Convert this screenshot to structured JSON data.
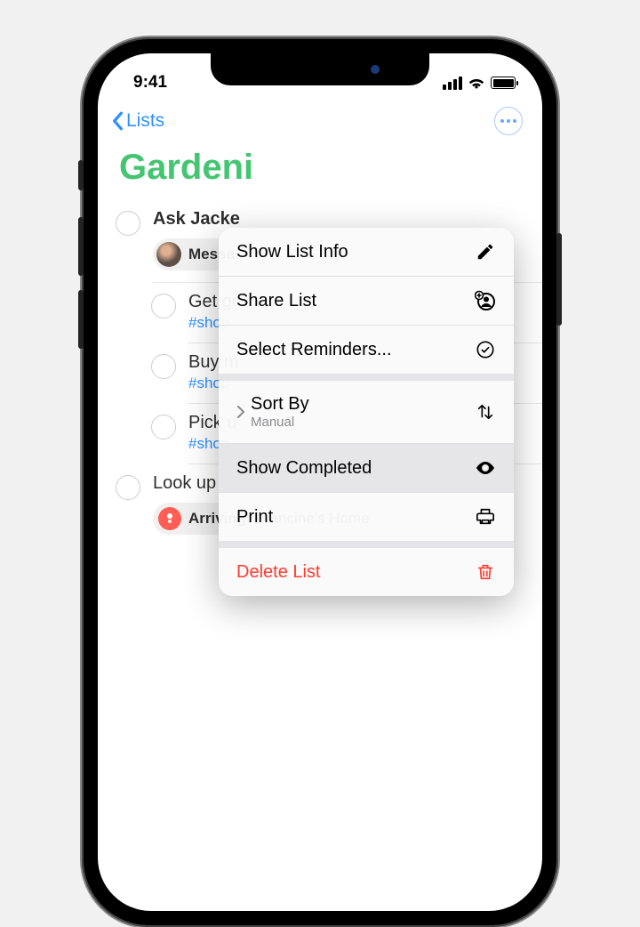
{
  "status": {
    "time": "9:41"
  },
  "nav": {
    "back_label": "Lists"
  },
  "list": {
    "title": "Gardeni"
  },
  "reminders": [
    {
      "title": "Ask Jacke",
      "bold": true,
      "chip_type": "message",
      "chip_label": "Messa",
      "indent": false
    },
    {
      "title": "Get gr",
      "tag": "#shop",
      "indent": true
    },
    {
      "title": "Buy m",
      "tag": "#shop",
      "indent": true
    },
    {
      "title": "Pick u",
      "tag": "#shop",
      "indent": true
    },
    {
      "title": "Look up native vines for along the fence",
      "indent": false,
      "chip_type": "location",
      "chip_label_bold": "Arriving:",
      "chip_label_rest": " Francine's Home"
    }
  ],
  "menu": {
    "show_list_info": "Show List Info",
    "share_list": "Share List",
    "select_reminders": "Select Reminders...",
    "sort_by_label": "Sort By",
    "sort_by_value": "Manual",
    "show_completed": "Show Completed",
    "print": "Print",
    "delete_list": "Delete List"
  }
}
